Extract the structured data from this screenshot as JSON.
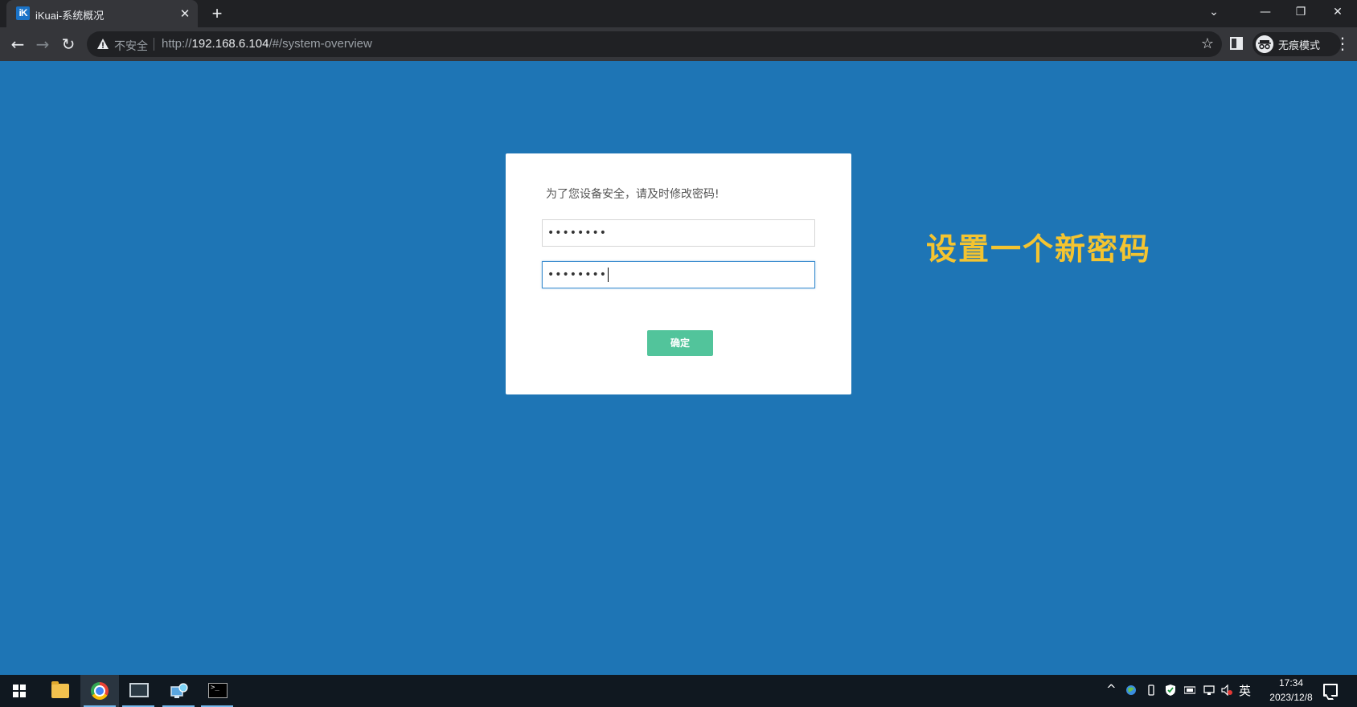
{
  "browser": {
    "tab": {
      "favicon_text": "iK",
      "title": "iKuai-系统概况",
      "close_glyph": "✕"
    },
    "new_tab_glyph": "+",
    "window_controls": {
      "tab_search_glyph": "⌄",
      "minimize_glyph": "—",
      "restore_glyph": "❐",
      "close_glyph": "✕"
    },
    "nav": {
      "back_glyph": "←",
      "forward_glyph": "→",
      "reload_glyph": "↻"
    },
    "omnibox": {
      "security_label": "不安全",
      "url_scheme": "http://",
      "url_host": "192.168.6.104",
      "url_path": "/#/system-overview",
      "bookmark_glyph": "☆"
    },
    "incognito_label": "无痕模式",
    "menu_glyph": "⋮"
  },
  "dialog": {
    "message": "为了您设备安全，请及时修改密码!",
    "new_password_value": "••••••••",
    "confirm_password_value": "••••••••",
    "confirm_label": "确定",
    "confirm_color": "#52c49b"
  },
  "annotation": {
    "text": "设置一个新密码",
    "color": "#f4c430"
  },
  "page": {
    "background_color": "#1e75b5"
  },
  "taskbar": {
    "apps": [
      "file-explorer-icon",
      "chrome-icon",
      "remote-desktop-icon",
      "network-tool-icon",
      "terminal-icon"
    ],
    "terminal_glyph": ">_",
    "tray_expand_glyph": "^",
    "ime_label": "英",
    "clock_time": "17:34",
    "clock_date": "2023/12/8"
  }
}
